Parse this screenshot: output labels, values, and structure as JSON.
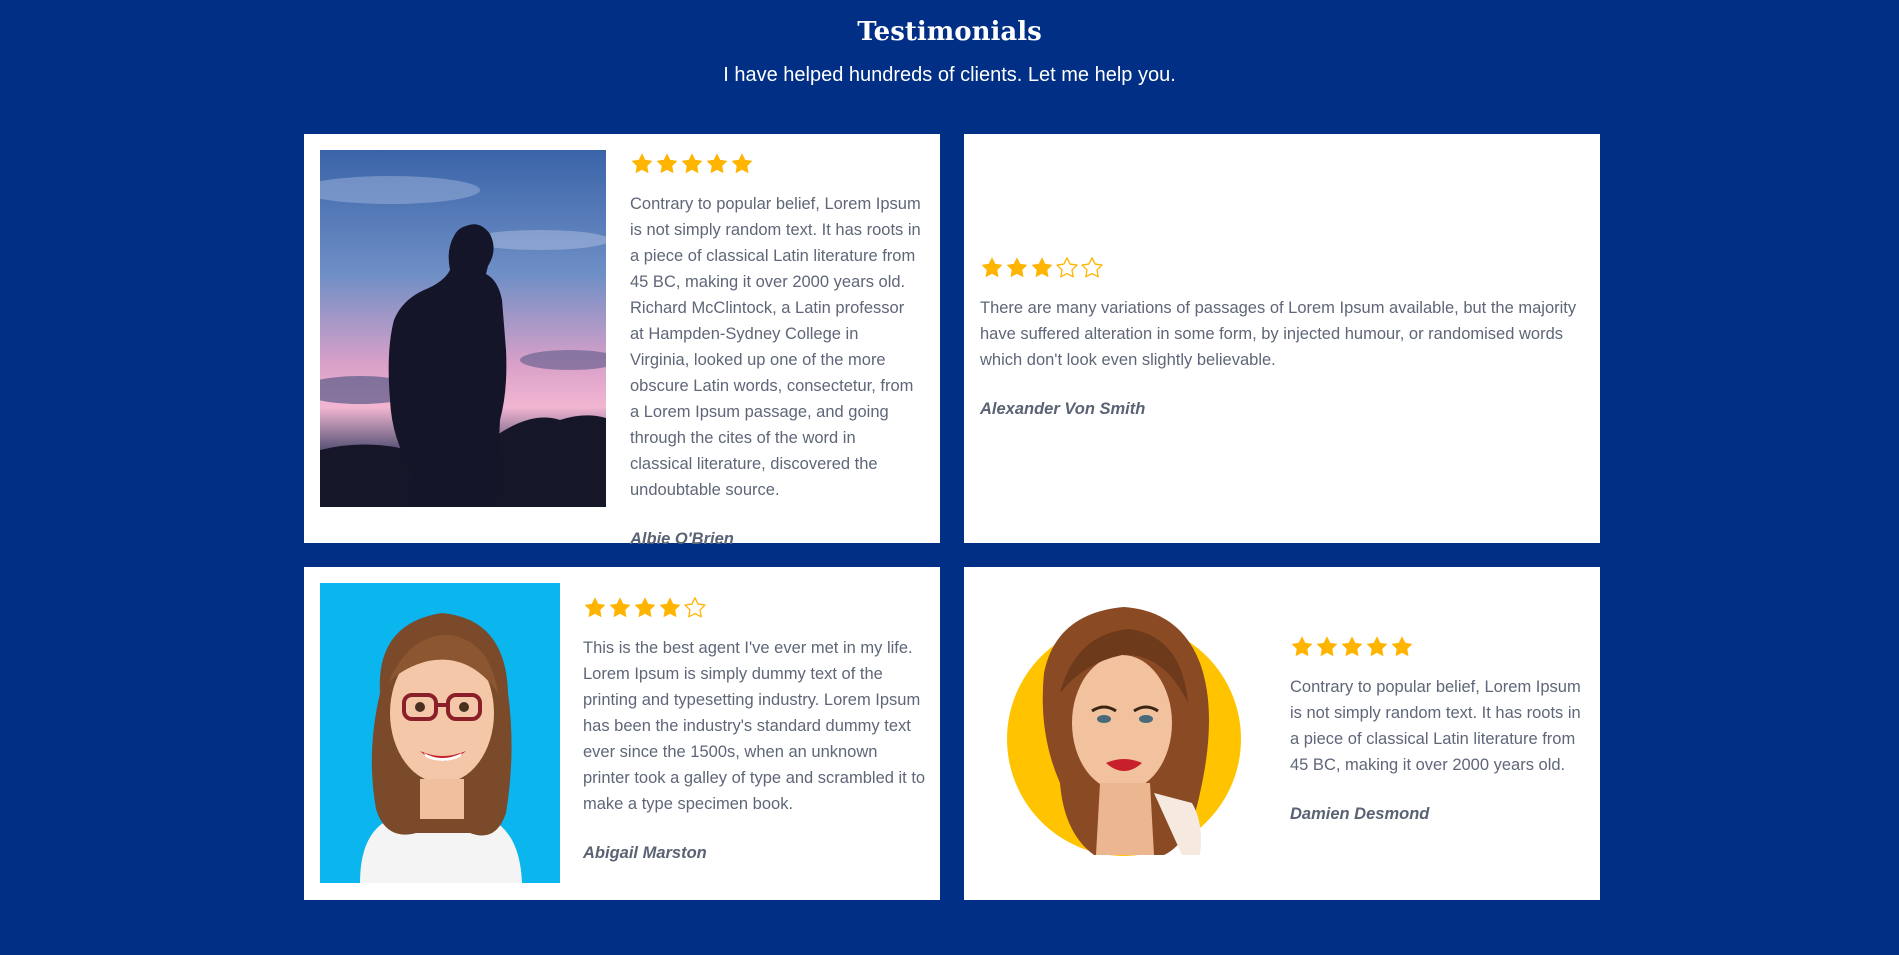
{
  "header": {
    "title": "Testimonials",
    "subtitle": "I have helped hundreds of clients. Let me help you."
  },
  "colors": {
    "background": "#002f85",
    "card": "#ffffff",
    "star": "#ffb400",
    "text": "#5e6678",
    "avatar_bg_blue": "#0bb5ee",
    "avatar_bg_yellow": "#ffc300"
  },
  "testimonials": [
    {
      "rating": 5,
      "max_rating": 5,
      "quote": "Contrary to popular belief, Lorem Ipsum is not simply random text. It has roots in a piece of classical Latin literature from 45 BC, making it over 2000 years old. Richard McClintock, a Latin professor at Hampden-Sydney College in Virginia, looked up one of the more obscure Latin words, consectetur, from a Lorem Ipsum passage, and going through the cites of the word in classical literature, discovered the undoubtable source.",
      "author": "Albie O'Brien",
      "photo": "silhouette-at-sunset-photo"
    },
    {
      "rating": 3,
      "max_rating": 5,
      "quote": "There are many variations of passages of Lorem Ipsum available, but the majority have suffered alteration in some form, by injected humour, or randomised words which don't look even slightly believable.",
      "author": "Alexander Von Smith"
    },
    {
      "rating": 4,
      "max_rating": 5,
      "quote": "This is the best agent I've ever met in my life. Lorem Ipsum is simply dummy text of the printing and typesetting industry. Lorem Ipsum has been the industry's standard dummy text ever since the 1500s, when an unknown printer took a galley of type and scrambled it to make a type specimen book.",
      "author": "Abigail Marston",
      "photo": "woman-with-glasses-illustration"
    },
    {
      "rating": 5,
      "max_rating": 5,
      "quote": "Contrary to popular belief, Lorem Ipsum is not simply random text. It has roots in a piece of classical Latin literature from 45 BC, making it over 2000 years old.",
      "author": "Damien Desmond",
      "photo": "woman-portrait-circle-illustration"
    }
  ]
}
